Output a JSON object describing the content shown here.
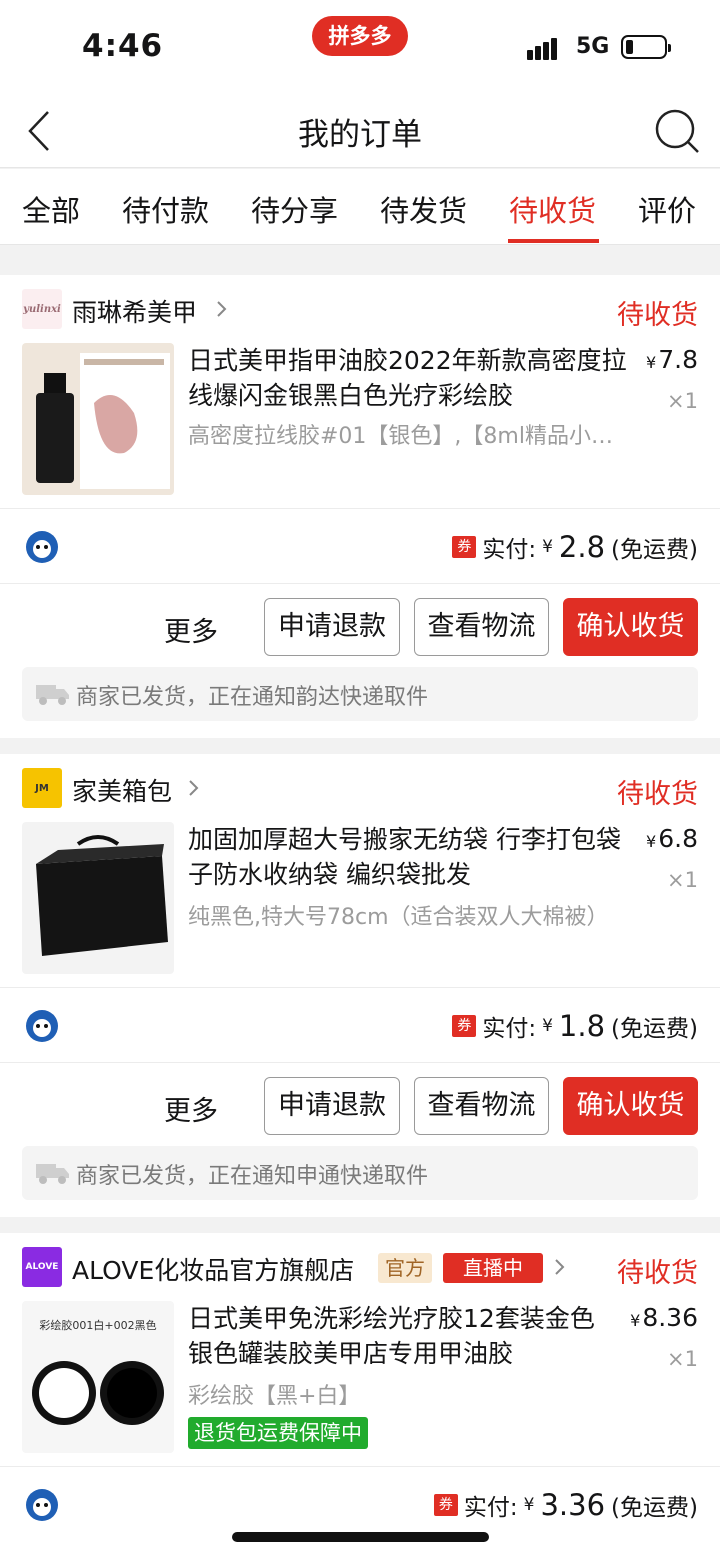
{
  "status_bar": {
    "time": "4:46",
    "app_badge": "拼多多",
    "network": "5G"
  },
  "nav": {
    "title": "我的订单"
  },
  "tabs": [
    {
      "label": "全部"
    },
    {
      "label": "待付款"
    },
    {
      "label": "待分享"
    },
    {
      "label": "待发货"
    },
    {
      "label": "待收货",
      "active": true
    },
    {
      "label": "评价"
    }
  ],
  "orders": [
    {
      "shop": {
        "name": "雨琳希美甲",
        "logo_text": "yulinxi"
      },
      "status": "待收货",
      "product": {
        "title": "日式美甲指甲油胶2022年新款高密度拉线爆闪金银黑白色光疗彩绘胶",
        "spec": "高密度拉线胶#01【银色】,【8ml精品小…",
        "price_symbol": "¥",
        "price": "7.8",
        "qty": "×1"
      },
      "payment": {
        "coupon": "券",
        "label": "实付:",
        "yen": "¥",
        "amount": "2.8",
        "shipping": "(免运费)"
      },
      "actions": {
        "more": "更多",
        "refund": "申请退款",
        "logistics": "查看物流",
        "confirm": "确认收货"
      },
      "logistics_text": "商家已发货，正在通知韵达快递取件"
    },
    {
      "shop": {
        "name": "家美箱包",
        "logo_text": "JM"
      },
      "status": "待收货",
      "product": {
        "title": "加固加厚超大号搬家无纺袋 行李打包袋子防水收纳袋 编织袋批发",
        "spec": "纯黑色,特大号78cm（适合装双人大棉被）",
        "price_symbol": "¥",
        "price": "6.8",
        "qty": "×1"
      },
      "payment": {
        "coupon": "券",
        "label": "实付:",
        "yen": "¥",
        "amount": "1.8",
        "shipping": "(免运费)"
      },
      "actions": {
        "more": "更多",
        "refund": "申请退款",
        "logistics": "查看物流",
        "confirm": "确认收货"
      },
      "logistics_text": "商家已发货，正在通知申通快递取件"
    },
    {
      "shop": {
        "name": "ALOVE化妆品官方旗舰店",
        "logo_text": "ALOVE",
        "badge_official": "官方",
        "badge_live": "直播中"
      },
      "status": "待收货",
      "product": {
        "title": "日式美甲免洗彩绘光疗胶12套装金色银色罐装胶美甲店专用甲油胶",
        "spec": "彩绘胶【黑+白】",
        "guarantee": "退货包运费保障中",
        "image_caption": "彩绘胶001白+002黑色",
        "price_symbol": "¥",
        "price": "8.36",
        "qty": "×1"
      },
      "payment": {
        "coupon": "券",
        "label": "实付:",
        "yen": "¥",
        "amount": "3.36",
        "shipping": "(免运费)"
      }
    }
  ],
  "colors": {
    "accent": "#e02e24",
    "guarantee_green": "#21ab2d",
    "muted_text": "#9c9c9c"
  }
}
